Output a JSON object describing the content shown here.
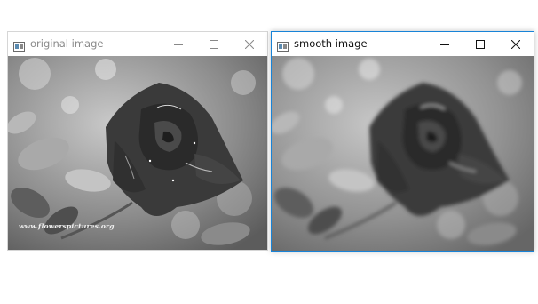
{
  "windows": [
    {
      "title": "original image",
      "icon": "app-window-icon",
      "controls": [
        "minimize-icon",
        "maximize-icon",
        "close-icon"
      ],
      "image": {
        "content": "grayscale rose photograph",
        "watermark": "www.flowerspictures.org"
      },
      "active": false
    },
    {
      "title": "smooth image",
      "icon": "app-window-icon",
      "controls": [
        "minimize-icon",
        "maximize-icon",
        "close-icon"
      ],
      "image": {
        "content": "blurred grayscale rose photograph"
      },
      "active": true
    }
  ],
  "colors": {
    "active_border": "#1883d7",
    "inactive_title": "#8a8a8a",
    "active_title": "#111111"
  }
}
